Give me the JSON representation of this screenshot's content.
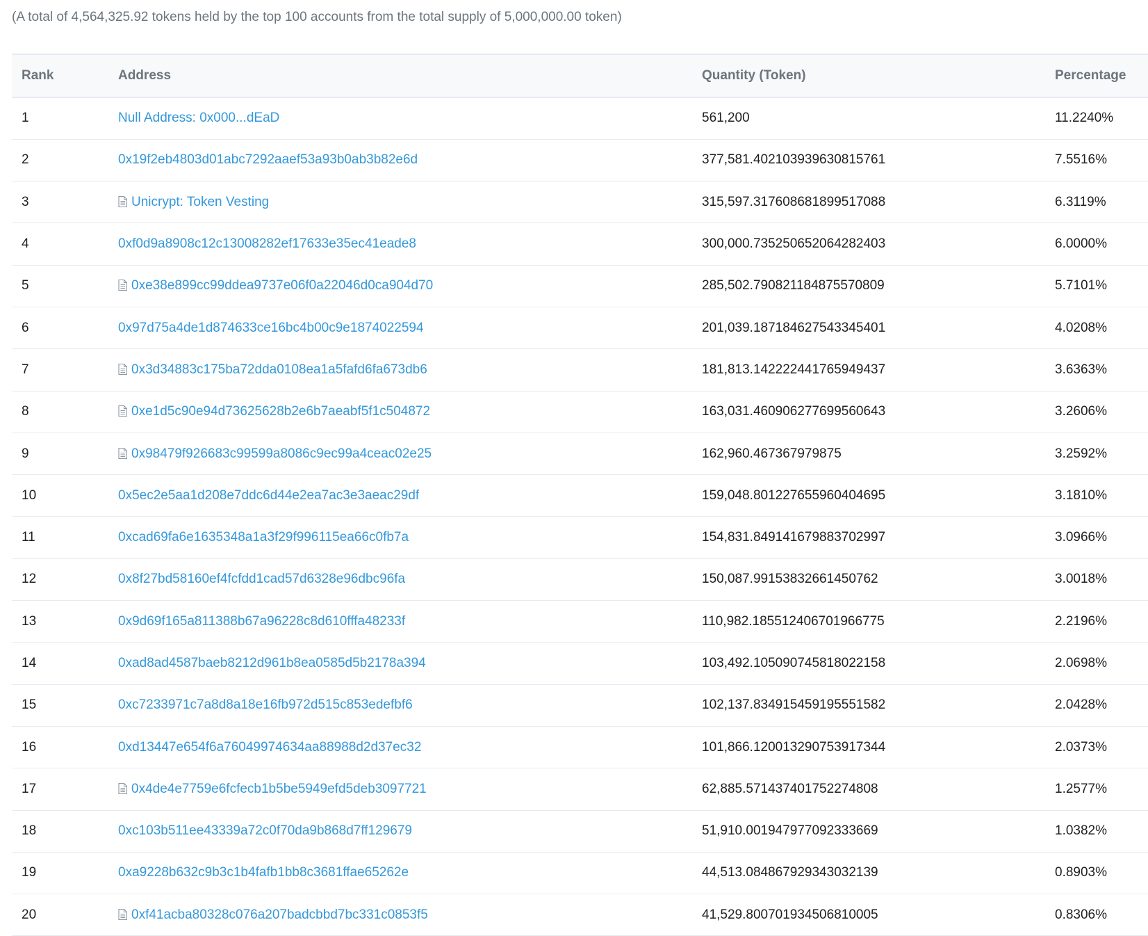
{
  "summary_text": "(A total of 4,564,325.92 tokens held by the top 100 accounts from the total supply of 5,000,000.00 token)",
  "columns": {
    "rank": "Rank",
    "address": "Address",
    "quantity": "Quantity (Token)",
    "percentage": "Percentage"
  },
  "colors": {
    "link": "#3498db",
    "header_text": "#6c757d",
    "divider": "#e7eaf3"
  },
  "rows": [
    {
      "rank": "1",
      "address": "Null Address: 0x000...dEaD",
      "contract": false,
      "quantity": "561,200",
      "percentage": "11.2240%"
    },
    {
      "rank": "2",
      "address": "0x19f2eb4803d01abc7292aaef53a93b0ab3b82e6d",
      "contract": false,
      "quantity": "377,581.402103939630815761",
      "percentage": "7.5516%"
    },
    {
      "rank": "3",
      "address": "Unicrypt: Token Vesting",
      "contract": true,
      "quantity": "315,597.317608681899517088",
      "percentage": "6.3119%"
    },
    {
      "rank": "4",
      "address": "0xf0d9a8908c12c13008282ef17633e35ec41eade8",
      "contract": false,
      "quantity": "300,000.735250652064282403",
      "percentage": "6.0000%"
    },
    {
      "rank": "5",
      "address": "0xe38e899cc99ddea9737e06f0a22046d0ca904d70",
      "contract": true,
      "quantity": "285,502.790821184875570809",
      "percentage": "5.7101%"
    },
    {
      "rank": "6",
      "address": "0x97d75a4de1d874633ce16bc4b00c9e1874022594",
      "contract": false,
      "quantity": "201,039.187184627543345401",
      "percentage": "4.0208%"
    },
    {
      "rank": "7",
      "address": "0x3d34883c175ba72dda0108ea1a5fafd6fa673db6",
      "contract": true,
      "quantity": "181,813.142222441765949437",
      "percentage": "3.6363%"
    },
    {
      "rank": "8",
      "address": "0xe1d5c90e94d73625628b2e6b7aeabf5f1c504872",
      "contract": true,
      "quantity": "163,031.460906277699560643",
      "percentage": "3.2606%"
    },
    {
      "rank": "9",
      "address": "0x98479f926683c99599a8086c9ec99a4ceac02e25",
      "contract": true,
      "quantity": "162,960.467367979875",
      "percentage": "3.2592%"
    },
    {
      "rank": "10",
      "address": "0x5ec2e5aa1d208e7ddc6d44e2ea7ac3e3aeac29df",
      "contract": false,
      "quantity": "159,048.801227655960404695",
      "percentage": "3.1810%"
    },
    {
      "rank": "11",
      "address": "0xcad69fa6e1635348a1a3f29f996115ea66c0fb7a",
      "contract": false,
      "quantity": "154,831.849141679883702997",
      "percentage": "3.0966%"
    },
    {
      "rank": "12",
      "address": "0x8f27bd58160ef4fcfdd1cad57d6328e96dbc96fa",
      "contract": false,
      "quantity": "150,087.99153832661450762",
      "percentage": "3.0018%"
    },
    {
      "rank": "13",
      "address": "0x9d69f165a811388b67a96228c8d610fffa48233f",
      "contract": false,
      "quantity": "110,982.185512406701966775",
      "percentage": "2.2196%"
    },
    {
      "rank": "14",
      "address": "0xad8ad4587baeb8212d961b8ea0585d5b2178a394",
      "contract": false,
      "quantity": "103,492.105090745818022158",
      "percentage": "2.0698%"
    },
    {
      "rank": "15",
      "address": "0xc7233971c7a8d8a18e16fb972d515c853edefbf6",
      "contract": false,
      "quantity": "102,137.834915459195551582",
      "percentage": "2.0428%"
    },
    {
      "rank": "16",
      "address": "0xd13447e654f6a76049974634aa88988d2d37ec32",
      "contract": false,
      "quantity": "101,866.120013290753917344",
      "percentage": "2.0373%"
    },
    {
      "rank": "17",
      "address": "0x4de4e7759e6fcfecb1b5be5949efd5deb3097721",
      "contract": true,
      "quantity": "62,885.571437401752274808",
      "percentage": "1.2577%"
    },
    {
      "rank": "18",
      "address": "0xc103b511ee43339a72c0f70da9b868d7ff129679",
      "contract": false,
      "quantity": "51,910.001947977092333669",
      "percentage": "1.0382%"
    },
    {
      "rank": "19",
      "address": "0xa9228b632c9b3c1b4fafb1bb8c3681ffae65262e",
      "contract": false,
      "quantity": "44,513.084867929343032139",
      "percentage": "0.8903%"
    },
    {
      "rank": "20",
      "address": "0xf41acba80328c076a207badcbbd7bc331c0853f5",
      "contract": true,
      "quantity": "41,529.800701934506810005",
      "percentage": "0.8306%"
    }
  ]
}
